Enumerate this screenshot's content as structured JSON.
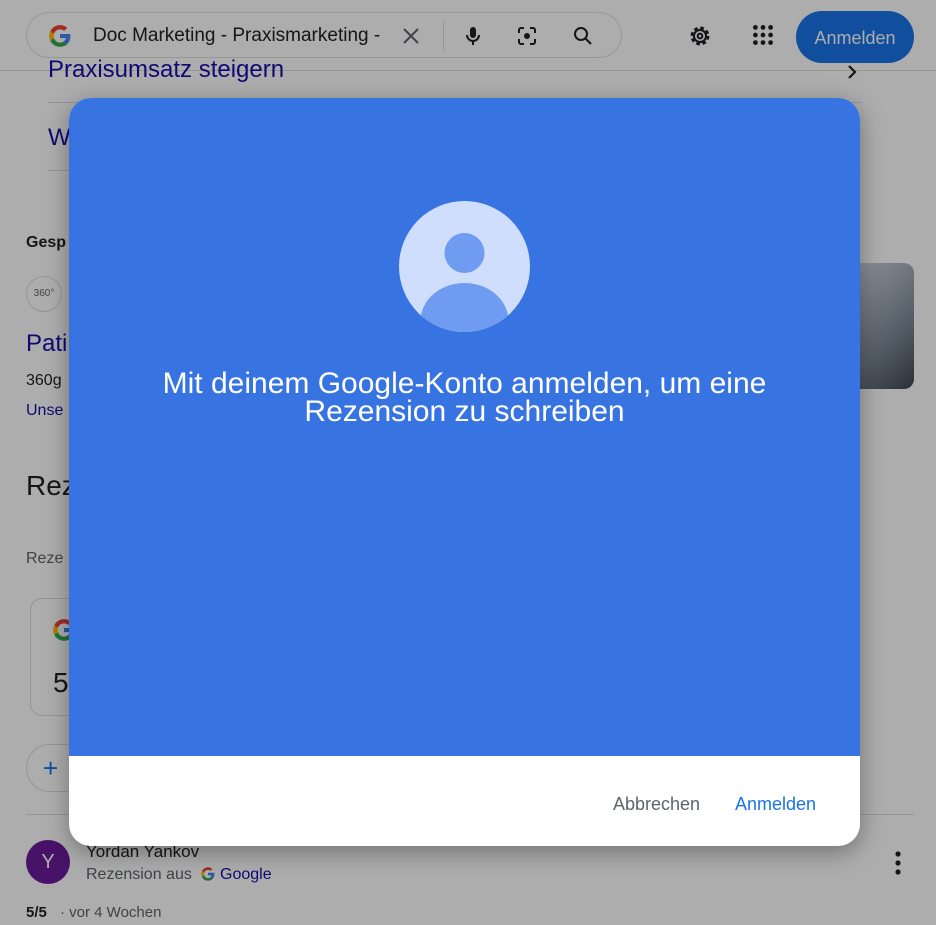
{
  "header": {
    "search_query": "Doc Marketing - Praxismarketing - Google Suche",
    "signin_label": "Anmelden"
  },
  "background": {
    "row1": "Praxisumsatz steigern",
    "row2": "W",
    "sponsored": "Gesp",
    "logo_text": "360°",
    "ad_title": "Pati",
    "ad_line": "360g",
    "ad_link": "Unse",
    "reviews_heading": "Rez",
    "reviews_sub": "Reze",
    "rating_partial": "5",
    "plus": "+",
    "reviewer": {
      "initial": "Y",
      "name": "Yordan Yankov",
      "source_prefix": "Rezension aus",
      "source_name": "Google",
      "score": "5/5",
      "age": "· vor 4 Wochen"
    }
  },
  "dialog": {
    "message_line1": "Mit deinem Google-Konto anmelden, um eine",
    "message_line2": "Rezension zu schreiben",
    "cancel_label": "Abbrechen",
    "signin_label": "Anmelden"
  },
  "colors": {
    "dialog_blue": "#3874e1",
    "google_blue": "#1a73e8",
    "link_blue": "#1a0dab"
  },
  "icons": [
    "google-logo-icon",
    "clear-icon",
    "microphone-icon",
    "lens-icon",
    "search-icon",
    "gear-icon",
    "apps-grid-icon",
    "chevron-right-icon",
    "kebab-menu-icon",
    "avatar-placeholder-icon"
  ]
}
